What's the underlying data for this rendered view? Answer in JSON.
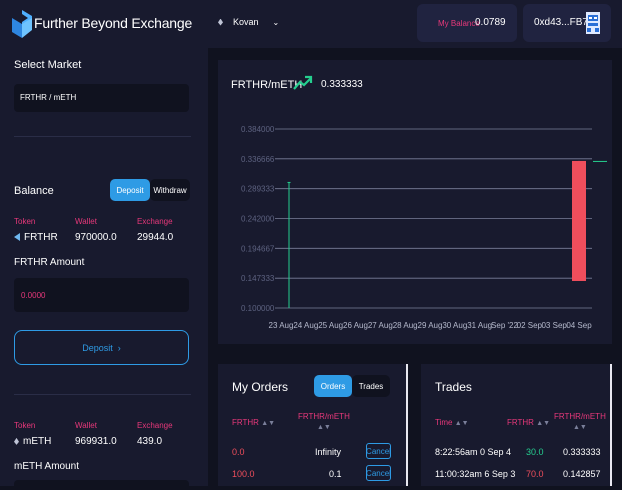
{
  "header": {
    "brand": "Further Beyond Exchange",
    "network": "Kovan",
    "balance_label": "My Balance",
    "balance_value": "0.0789",
    "account": "0xd43...FB7b"
  },
  "sidebar": {
    "select_market_title": "Select Market",
    "market_value": "FRTHR / mETH",
    "balance_title": "Balance",
    "toggle": {
      "deposit": "Deposit",
      "withdraw": "Withdraw"
    },
    "columns": {
      "token": "Token",
      "wallet": "Wallet",
      "exchange": "Exchange"
    },
    "token1": {
      "name": "FRTHR",
      "wallet": "970000.0",
      "exchange": "29944.0"
    },
    "amount1_label": "FRTHR Amount",
    "amount1_placeholder": "0.0000",
    "deposit_button": "Deposit",
    "token2": {
      "name": "mETH",
      "wallet": "969931.0",
      "exchange": "439.0"
    },
    "amount2_label": "mETH Amount"
  },
  "chart": {
    "pair": "FRTHR/mETH",
    "price": "0.333333",
    "colors": {
      "up": "#25ce8f",
      "down": "#ef4e5c",
      "grid": "#7a7f9a"
    }
  },
  "chart_data": {
    "type": "candlestick",
    "ylim": [
      0.1,
      0.384
    ],
    "y_ticks": [
      "0.384000",
      "0.336666",
      "0.289333",
      "0.242000",
      "0.194667",
      "0.147333",
      "0.100000"
    ],
    "x_ticks": [
      "23 Aug",
      "24 Aug",
      "25 Aug",
      "26 Aug",
      "27 Aug",
      "28 Aug",
      "29 Aug",
      "30 Aug",
      "31 Aug",
      "Sep '22",
      "02 Sep",
      "03 Sep",
      "04 Sep"
    ],
    "candles": [
      {
        "x": "23 Aug",
        "open": 0.3,
        "close": 0.3,
        "high": 0.3,
        "low": 0.1,
        "dir": "up"
      },
      {
        "x": "04 Sep",
        "open": 0.333333,
        "close": 0.142857,
        "high": 0.333333,
        "low": 0.142857,
        "dir": "down"
      },
      {
        "x": "04 Sep",
        "open": 0.333333,
        "close": 0.333333,
        "high": 0.333333,
        "low": 0.333333,
        "dir": "up"
      }
    ]
  },
  "orders": {
    "title": "My Orders",
    "tabs": {
      "orders": "Orders",
      "trades": "Trades"
    },
    "headers": {
      "token": "FRTHR",
      "price": "FRTHR/mETH"
    },
    "rows": [
      {
        "amount": "0.0",
        "price": "Infinity",
        "action": "Cancel"
      },
      {
        "amount": "100.0",
        "price": "0.1",
        "action": "Cancel"
      }
    ]
  },
  "trades": {
    "title": "Trades",
    "headers": {
      "time": "Time",
      "token": "FRTHR",
      "price": "FRTHR/mETH"
    },
    "rows": [
      {
        "time": "8:22:56am 0 Sep 4",
        "amount": "30.0",
        "price": "0.333333",
        "color": "#25ce8f"
      },
      {
        "time": "11:00:32am 6 Sep 3",
        "amount": "70.0",
        "price": "0.142857",
        "color": "#ef4e5c"
      }
    ]
  }
}
